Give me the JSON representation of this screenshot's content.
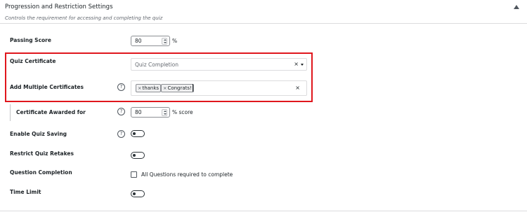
{
  "header": {
    "title": "Progression and Restriction Settings",
    "subtitle": "Controls the requirement for accessing and completing the quiz"
  },
  "passing_score": {
    "label": "Passing Score",
    "value": "80",
    "suffix": "%"
  },
  "quiz_certificate": {
    "label": "Quiz Certificate",
    "selected": "Quiz Completion",
    "clear": "×"
  },
  "multiple_certificates": {
    "label": "Add Multiple Certificates",
    "help": "?",
    "tags": [
      {
        "remove": "×",
        "label": "thanks"
      },
      {
        "remove": "×",
        "label": "Congrats!"
      }
    ],
    "clear": "×"
  },
  "certificate_awarded": {
    "label": "Certificate Awarded for",
    "help": "?",
    "value": "80",
    "suffix": "% score"
  },
  "enable_quiz_saving": {
    "label": "Enable Quiz Saving",
    "help": "?",
    "enabled": false
  },
  "restrict_quiz_retakes": {
    "label": "Restrict Quiz Retakes",
    "enabled": false
  },
  "question_completion": {
    "label": "Question Completion",
    "checkbox_label": "All Questions required to complete",
    "checked": false
  },
  "time_limit": {
    "label": "Time Limit",
    "enabled": false
  },
  "colors": {
    "highlight": "#e0161d",
    "border": "#dcdcde",
    "text": "#1d2327"
  },
  "icons": [
    "chevron-up-icon",
    "help-icon",
    "caret-down-icon",
    "close-icon",
    "toggle-icon",
    "spinner-icon"
  ]
}
